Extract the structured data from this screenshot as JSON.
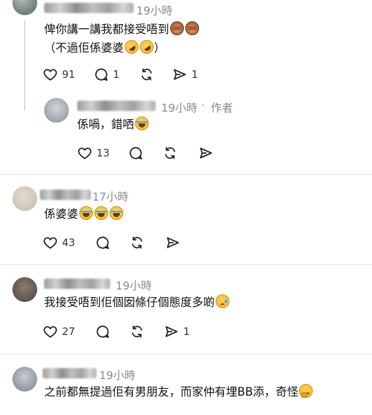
{
  "comments": [
    {
      "time": "19小時",
      "lines": [
        "俾你講一講我都接受唔到",
        "（不過佢係婆婆"
      ],
      "line2_end": "）",
      "stats": {
        "likes": "91",
        "replies": "1",
        "reposts": "",
        "shares": "1"
      },
      "emojis": [
        "see-no-evil-monkey-emoji",
        "see-no-evil-monkey-emoji",
        "rofl-emoji",
        "rofl-emoji"
      ]
    },
    {
      "time": "19小時",
      "author_tag": "作者",
      "separator": "·",
      "text": "係喎，錯哂",
      "stats": {
        "likes": "13",
        "replies": "",
        "reposts": "",
        "shares": ""
      },
      "emojis": [
        "tears-of-joy-emoji"
      ]
    },
    {
      "time": "17小時",
      "text": "係婆婆",
      "stats": {
        "likes": "43",
        "replies": "",
        "reposts": "",
        "shares": ""
      },
      "emojis": [
        "tears-of-joy-emoji",
        "tears-of-joy-emoji",
        "tears-of-joy-emoji"
      ]
    },
    {
      "time": "19小時",
      "text": "我接受唔到佢個囡條仔個態度多啲",
      "stats": {
        "likes": "27",
        "replies": "",
        "reposts": "",
        "shares": "1"
      },
      "emojis": [
        "sad-face-emoji"
      ]
    },
    {
      "time": "19小時",
      "text": "之前都無提過佢有男朋友，而家仲有埋BB添，奇怪",
      "emojis": [
        "thinking-face-emoji"
      ]
    }
  ],
  "icons": {
    "like": "heart-icon",
    "reply": "comment-icon",
    "repost": "repost-icon",
    "share": "send-icon"
  }
}
